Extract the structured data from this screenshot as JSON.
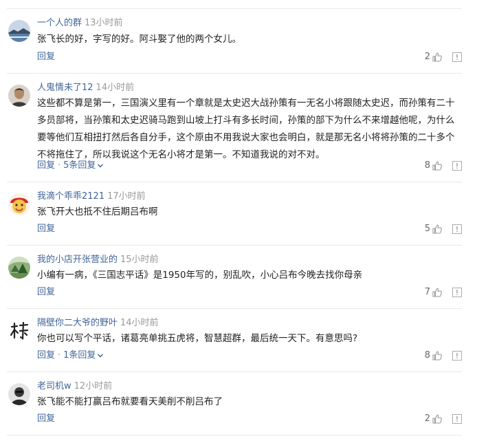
{
  "comments": [
    {
      "username": "一个人的群",
      "time": "13小时前",
      "text": "张飞长的好，字写的好。阿斗娶了他的两个女儿。",
      "reply_label": "回复",
      "replies_label": "",
      "likes": "2",
      "avatar": "landscape-avatar"
    },
    {
      "username": "人鬼情未了12",
      "time": "14小时前",
      "text": "这些都不算是第一，三国演义里有一个章就是太史迟大战孙策有一无名小将跟随太史迟，而孙策有二十多员部将，当孙策和太史迟骑马跑到山坡上打斗有多长时间，孙策的部下为什么不来增越他呢，为什么要等他们互相扭打然后各自分手，这个原由不用我说大家也会明白，就是那无名小将将孙策的二十多个不将拖住了，所以我说这个无名小将才是第一。不知道我说的对不对。",
      "reply_label": "回复",
      "replies_label": "5条回复",
      "likes": "8",
      "avatar": "person-avatar"
    },
    {
      "username": "我滴个乖乖2121",
      "time": "17小时前",
      "text": "张飞开大也抵不住后期吕布啊",
      "reply_label": "回复",
      "replies_label": "",
      "likes": "5",
      "avatar": "cartoon-avatar"
    },
    {
      "username": "我的小店开张营业的",
      "time": "15小时前",
      "text": "小编有一病，《三国志平话》是1950年写的，别乱吹，小心吕布今晚去找你母亲",
      "reply_label": "回复",
      "replies_label": "",
      "likes": "7",
      "avatar": "nature-avatar"
    },
    {
      "username": "隔壁你二大爷的野叶",
      "time": "14小时前",
      "text": "你也可以写个平话，诸葛亮单挑五虎将，智慧超群，最后统一天下。有意思吗?",
      "reply_label": "回复",
      "replies_label": "1条回复",
      "likes": "8",
      "avatar": "calligraphy-avatar"
    },
    {
      "username": "老司机w",
      "time": "12小时前",
      "text": "张飞能不能打赢吕布就要看天美削不削吕布了",
      "reply_label": "回复",
      "replies_label": "",
      "likes": "2",
      "avatar": "dark-avatar"
    }
  ],
  "colors": {
    "username": "#406599",
    "time": "#999999",
    "text": "#222222",
    "divider": "#e8e8e8"
  },
  "icons": {
    "like": "thumbs-up-icon",
    "report": "report-flag-icon",
    "expand": "chevron-down-icon"
  }
}
